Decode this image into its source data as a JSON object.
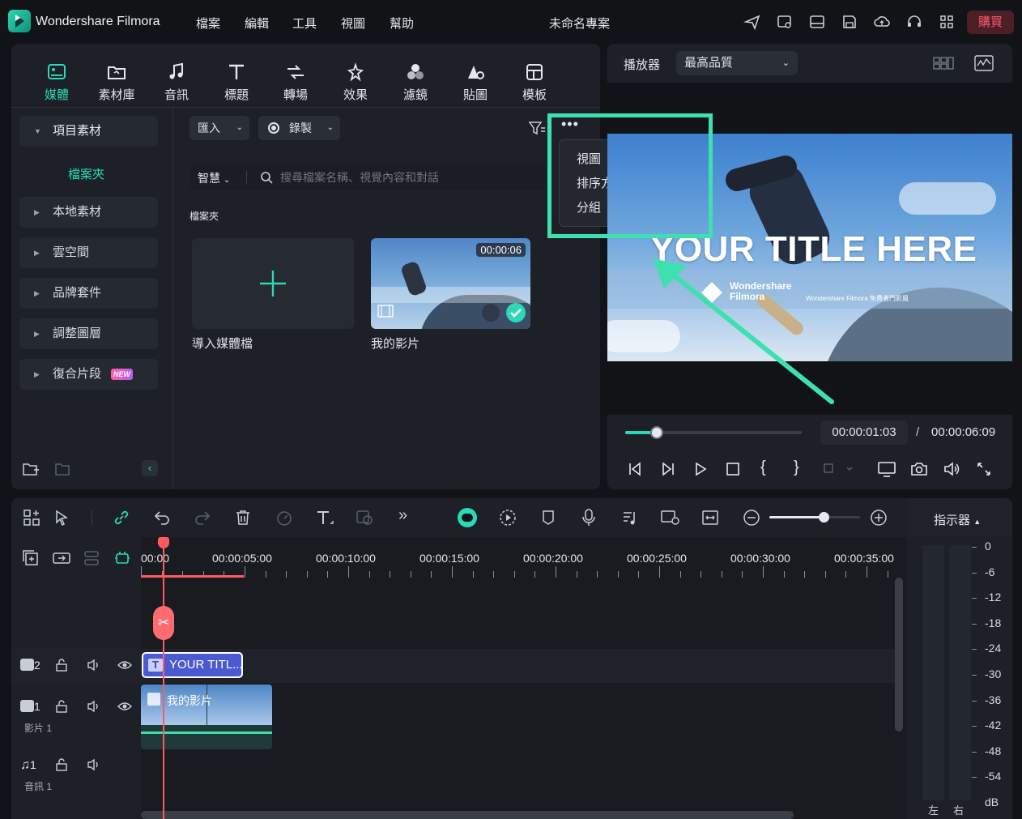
{
  "app": {
    "name": "Wondershare Filmora",
    "project_title": "未命名專案",
    "buy_label": "購買"
  },
  "menu": [
    "檔案",
    "編輯",
    "工具",
    "視圖",
    "幫助"
  ],
  "tabs": [
    {
      "label": "媒體",
      "icon": "media-icon"
    },
    {
      "label": "素材庫",
      "icon": "library-icon"
    },
    {
      "label": "音訊",
      "icon": "music-icon"
    },
    {
      "label": "標題",
      "icon": "title-icon"
    },
    {
      "label": "轉場",
      "icon": "transition-icon"
    },
    {
      "label": "效果",
      "icon": "effects-icon"
    },
    {
      "label": "濾鏡",
      "icon": "filter-icon"
    },
    {
      "label": "貼圖",
      "icon": "sticker-icon"
    },
    {
      "label": "模板",
      "icon": "template-icon"
    }
  ],
  "sidebar": {
    "project_media": "項目素材",
    "folder": "檔案夾",
    "items": [
      "本地素材",
      "雲空間",
      "品牌套件",
      "調整圖層",
      "復合片段"
    ],
    "new_badge": "NEW"
  },
  "toolbar": {
    "import": "匯入",
    "record": "錄製",
    "smart": "智慧",
    "search_placeholder": "搜尋檔案名稱、視覺內容和對話"
  },
  "folder_label": "檔案夾",
  "media": {
    "import_label": "導入媒體檔",
    "clip_label": "我的影片",
    "clip_duration": "00:00:06"
  },
  "context_menu": [
    "視圖",
    "排序方式",
    "分組"
  ],
  "player": {
    "label": "播放器",
    "quality": "最高品質",
    "current_time": "00:00:01:03",
    "separator": "/",
    "total_time": "00:00:06:09",
    "progress": 0.18
  },
  "preview": {
    "title_text": "YOUR TITLE HERE",
    "brand_line1": "Wondershare",
    "brand_line2": "Filmora",
    "brand_note": "Wondershare Filmora 免費者門影風"
  },
  "timeline": {
    "ruler": [
      "00:00",
      "00:00:05:00",
      "00:00:10:00",
      "00:00:15:00",
      "00:00:20:00",
      "00:00:25:00",
      "00:00:30:00",
      "00:00:35:00"
    ],
    "tracks": [
      {
        "num": "2",
        "label": ""
      },
      {
        "num": "1",
        "label": "影片 1"
      },
      {
        "num": "1",
        "label": "音訊 1"
      }
    ],
    "title_clip": "YOUR TITL...",
    "video_clip": "我的影片"
  },
  "meter": {
    "label": "指示器",
    "scale": [
      "0",
      "-6",
      "-12",
      "-18",
      "-24",
      "-30",
      "-36",
      "-42",
      "-48",
      "-54",
      "dB"
    ],
    "left": "左",
    "right": "右"
  },
  "colors": {
    "accent": "#2bd9b8",
    "highlight": "#3fe0b0",
    "playhead": "#ff5a5f",
    "title_clip": "#4a5bd1"
  }
}
